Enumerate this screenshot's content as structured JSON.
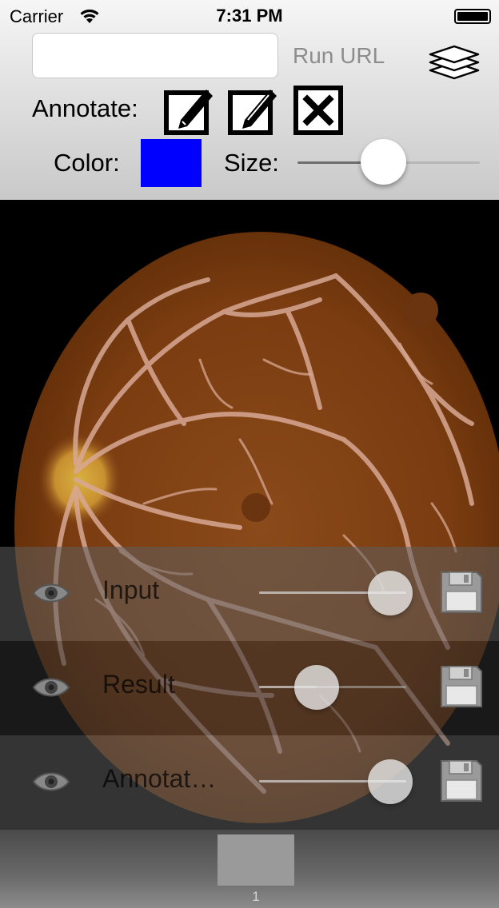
{
  "status_bar": {
    "carrier": "Carrier",
    "time": "7:31 PM"
  },
  "toolbar": {
    "url_value": "",
    "run_url_label": "Run URL",
    "layers_icon": "layers-icon",
    "annotate_label": "Annotate:",
    "annotate_tools": [
      "edit-icon",
      "edit-alt-icon",
      "clear-icon"
    ],
    "color_label": "Color:",
    "color_value": "#0000ff",
    "size_label": "Size:",
    "size_level": 0.47
  },
  "layers": [
    {
      "name": "Input",
      "opacity": 1.0
    },
    {
      "name": "Result",
      "opacity": 0.39
    },
    {
      "name": "Annotat…",
      "opacity": 1.0
    }
  ],
  "pages": {
    "current": "1"
  }
}
